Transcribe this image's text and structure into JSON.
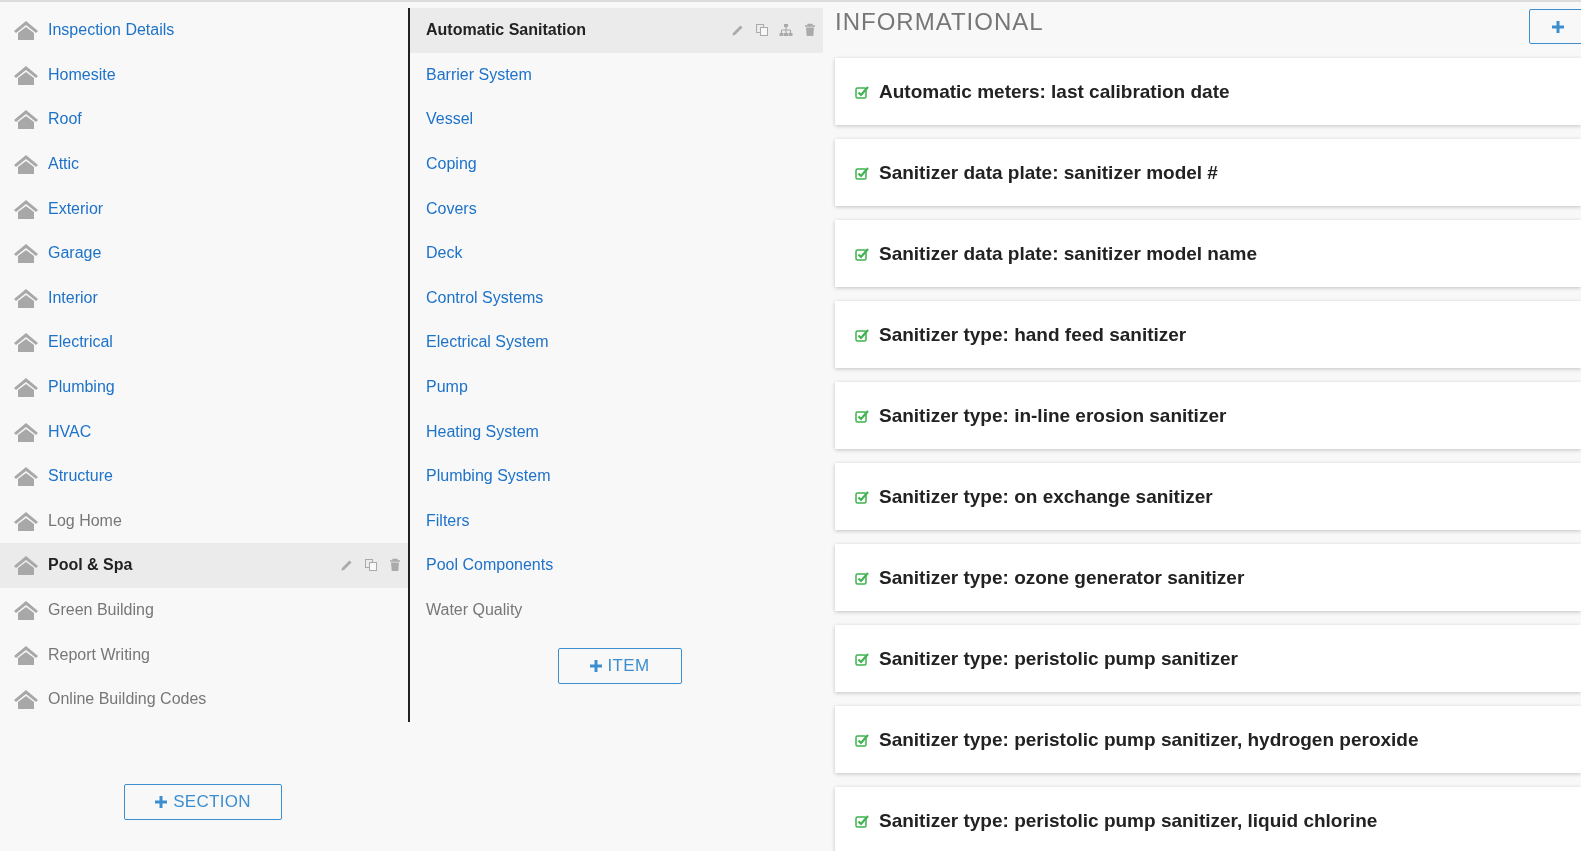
{
  "sections": [
    {
      "label": "Inspection Details",
      "selected": false,
      "dimmed": false
    },
    {
      "label": "Homesite",
      "selected": false,
      "dimmed": false
    },
    {
      "label": "Roof",
      "selected": false,
      "dimmed": false
    },
    {
      "label": "Attic",
      "selected": false,
      "dimmed": false
    },
    {
      "label": "Exterior",
      "selected": false,
      "dimmed": false
    },
    {
      "label": "Garage",
      "selected": false,
      "dimmed": false
    },
    {
      "label": "Interior",
      "selected": false,
      "dimmed": false
    },
    {
      "label": "Electrical",
      "selected": false,
      "dimmed": false
    },
    {
      "label": "Plumbing",
      "selected": false,
      "dimmed": false
    },
    {
      "label": "HVAC",
      "selected": false,
      "dimmed": false
    },
    {
      "label": "Structure",
      "selected": false,
      "dimmed": false
    },
    {
      "label": "Log Home",
      "selected": false,
      "dimmed": true
    },
    {
      "label": "Pool & Spa",
      "selected": true,
      "dimmed": false
    },
    {
      "label": "Green Building",
      "selected": false,
      "dimmed": true
    },
    {
      "label": "Report Writing",
      "selected": false,
      "dimmed": true
    },
    {
      "label": "Online Building Codes",
      "selected": false,
      "dimmed": true
    }
  ],
  "add_section_button": "SECTION",
  "items": [
    {
      "label": "Automatic Sanitation",
      "selected": true,
      "dimmed": false
    },
    {
      "label": "Barrier System",
      "selected": false,
      "dimmed": false
    },
    {
      "label": "Vessel",
      "selected": false,
      "dimmed": false
    },
    {
      "label": "Coping",
      "selected": false,
      "dimmed": false
    },
    {
      "label": "Covers",
      "selected": false,
      "dimmed": false
    },
    {
      "label": "Deck",
      "selected": false,
      "dimmed": false
    },
    {
      "label": "Control Systems",
      "selected": false,
      "dimmed": false
    },
    {
      "label": "Electrical System",
      "selected": false,
      "dimmed": false
    },
    {
      "label": "Pump",
      "selected": false,
      "dimmed": false
    },
    {
      "label": "Heating System",
      "selected": false,
      "dimmed": false
    },
    {
      "label": "Plumbing System",
      "selected": false,
      "dimmed": false
    },
    {
      "label": "Filters",
      "selected": false,
      "dimmed": false
    },
    {
      "label": "Pool Components",
      "selected": false,
      "dimmed": false
    },
    {
      "label": "Water Quality",
      "selected": false,
      "dimmed": true
    }
  ],
  "add_item_button": "ITEM",
  "panel_title": "INFORMATIONAL",
  "comments": [
    {
      "text": "Automatic meters: last calibration date",
      "checked": true
    },
    {
      "text": "Sanitizer data plate: sanitizer model #",
      "checked": true
    },
    {
      "text": "Sanitizer data plate: sanitizer model name",
      "checked": true
    },
    {
      "text": "Sanitizer type: hand feed sanitizer",
      "checked": true
    },
    {
      "text": "Sanitizer type: in-line erosion sanitizer",
      "checked": true
    },
    {
      "text": "Sanitizer type: on exchange sanitizer",
      "checked": true
    },
    {
      "text": "Sanitizer type: ozone generator sanitizer",
      "checked": true
    },
    {
      "text": "Sanitizer type: peristolic pump sanitizer",
      "checked": true
    },
    {
      "text": "Sanitizer type: peristolic pump sanitizer, hydrogen peroxide",
      "checked": true
    },
    {
      "text": "Sanitizer type: peristolic pump sanitizer, liquid chlorine",
      "checked": true
    }
  ]
}
